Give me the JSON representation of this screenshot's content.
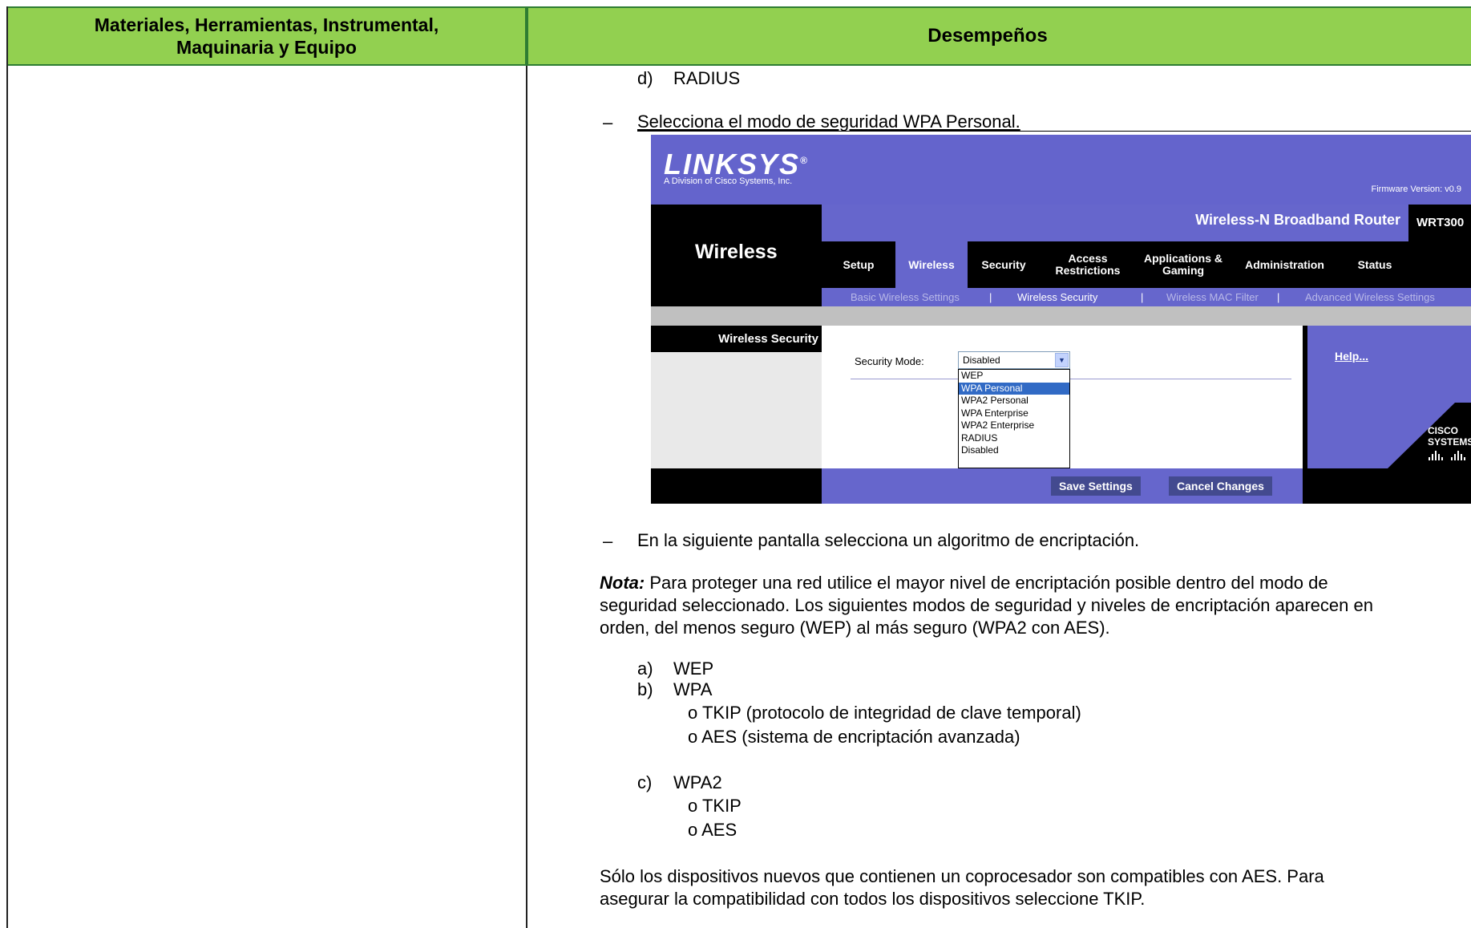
{
  "table": {
    "header_left_line1": "Materiales, Herramientas, Instrumental,",
    "header_left_line2": "Maquinaria y Equipo",
    "header_right": "Desempeños"
  },
  "content": {
    "item_d_letter": "d)",
    "item_d": "RADIUS",
    "bullet1": "Selecciona el modo de seguridad WPA Personal.",
    "bullet2": "En la siguiente pantalla selecciona un algoritmo de encriptación.",
    "nota_label": "Nota:",
    "nota_line1": " Para proteger una red utilice el mayor nivel de encriptación posible dentro del modo de",
    "nota_line2": "seguridad seleccionado. Los siguientes modos de seguridad y niveles de encriptación aparecen en",
    "nota_line3": "orden, del menos seguro (WEP) al más seguro (WPA2 con AES).",
    "list": {
      "a_letter": "a)",
      "a": "WEP",
      "b_letter": "b)",
      "b": "WPA",
      "b_sub1": "o  TKIP (protocolo de integridad de clave temporal)",
      "b_sub2": "o  AES (sistema de encriptación avanzada)",
      "c_letter": "c)",
      "c": "WPA2",
      "c_sub1": "o  TKIP",
      "c_sub2": "o  AES"
    },
    "final_line1": "Sólo los dispositivos nuevos que contienen un coprocesador son compatibles con AES. Para",
    "final_line2": "asegurar la compatibilidad con todos los dispositivos seleccione TKIP."
  },
  "router": {
    "logo": "LINKSYS",
    "logo_sub": "A Division of Cisco Systems, Inc.",
    "firmware": "Firmware Version: v0.9",
    "product": "Wireless-N Broadband Router",
    "model": "WRT300",
    "section": "Wireless",
    "tabs": [
      "Setup",
      "Wireless",
      "Security",
      "Access Restrictions",
      "Applications & Gaming",
      "Administration",
      "Status"
    ],
    "subnav": [
      "Basic Wireless Settings",
      "|",
      "Wireless Security",
      "|",
      "Wireless MAC Filter",
      "|",
      "Advanced Wireless Settings"
    ],
    "left_title": "Wireless Security",
    "field_label": "Security Mode:",
    "select_value": "Disabled",
    "options": [
      "WEP",
      "WPA Personal",
      "WPA2 Personal",
      "WPA Enterprise",
      "WPA2 Enterprise",
      "RADIUS",
      "Disabled"
    ],
    "help": "Help...",
    "cisco": "CISCO SYSTEMS",
    "save_button": "Save Settings",
    "cancel_button": "Cancel Changes"
  }
}
